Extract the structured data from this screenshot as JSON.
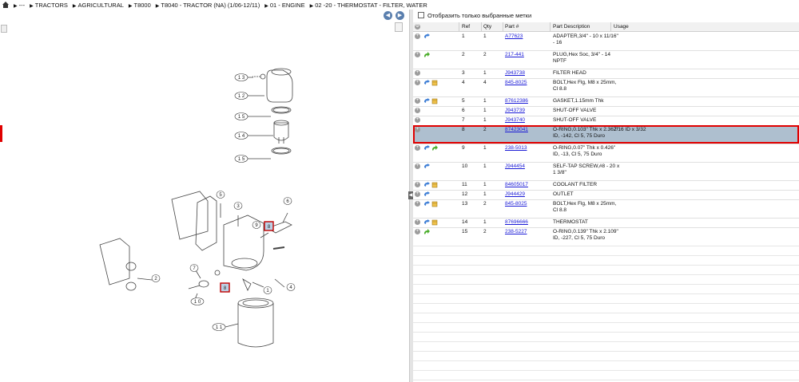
{
  "breadcrumb": {
    "items": [
      {
        "label": "---"
      },
      {
        "label": "TRACTORS"
      },
      {
        "label": "AGRICULTURAL"
      },
      {
        "label": "T8000"
      },
      {
        "label": "T8040 - TRACTOR (NA) (1/06-12/11)"
      },
      {
        "label": "01 - ENGINE"
      },
      {
        "label": "02 -20 - THERMOSTAT - FILTER, WATER"
      }
    ]
  },
  "nav": {
    "back": "◀",
    "forward": "▶"
  },
  "filter": {
    "label": "Отобразить только выбранные метки"
  },
  "table": {
    "headers": {
      "ref": "Ref",
      "qty": "Qty",
      "part": "Part #",
      "desc": "Part Description",
      "usage": "Usage"
    },
    "rows": [
      {
        "ref": "1",
        "qty": "1",
        "part": "A77623",
        "desc1": "ADAPTER,3/4\" - 10 x 11/16\"",
        "desc2": "- 16",
        "usage": "",
        "icons": "blue"
      },
      {
        "ref": "2",
        "qty": "2",
        "part": "217-441",
        "desc1": "PLUG,Hex Soc, 3/4\" - 14",
        "desc2": "NPTF",
        "usage": "",
        "icons": "green"
      },
      {
        "ref": "3",
        "qty": "1",
        "part": "J943738",
        "desc1": "FILTER HEAD",
        "desc2": "",
        "usage": "",
        "icons": "none"
      },
      {
        "ref": "4",
        "qty": "4",
        "part": "845-8025",
        "desc1": "BOLT,Hex Flg, M8 x 25mm,",
        "desc2": "Cl 8.8",
        "usage": "",
        "icons": "blue-box"
      },
      {
        "ref": "5",
        "qty": "1",
        "part": "87612386",
        "desc1": "GASKET,1.15mm Thk",
        "desc2": "",
        "usage": "",
        "icons": "blue-box"
      },
      {
        "ref": "6",
        "qty": "1",
        "part": "J943739",
        "desc1": "SHUT-OFF VALVE",
        "desc2": "",
        "usage": "",
        "icons": "none"
      },
      {
        "ref": "7",
        "qty": "1",
        "part": "J943740",
        "desc1": "SHUT-OFF VALVE",
        "desc2": "",
        "usage": "",
        "icons": "none"
      },
      {
        "ref": "8",
        "qty": "2",
        "part": "87423041",
        "desc1": "O-RING,0.103\" Thk x 2.362\"",
        "desc2": "ID, -142, Cl 5, 75 Duro",
        "usage": "7/16 ID x 3/32",
        "icons": "none"
      },
      {
        "ref": "9",
        "qty": "1",
        "part": "238-5013",
        "desc1": "O-RING,0.07\" Thk x 0.426\"",
        "desc2": "ID, -13, Cl 5, 75 Duro",
        "usage": "",
        "icons": "blue-green"
      },
      {
        "ref": "10",
        "qty": "1",
        "part": "J944454",
        "desc1": "SELF-TAP SCREW,#8 - 20 x",
        "desc2": "1 3/8\"",
        "usage": "",
        "icons": "blue"
      },
      {
        "ref": "11",
        "qty": "1",
        "part": "84605017",
        "desc1": "COOLANT FILTER",
        "desc2": "",
        "usage": "",
        "icons": "blue-box"
      },
      {
        "ref": "12",
        "qty": "1",
        "part": "J944429",
        "desc1": "OUTLET",
        "desc2": "",
        "usage": "",
        "icons": "blue"
      },
      {
        "ref": "13",
        "qty": "2",
        "part": "845-8025",
        "desc1": "BOLT,Hex Flg, M8 x 25mm,",
        "desc2": "Cl 8.8",
        "usage": "",
        "icons": "blue-box"
      },
      {
        "ref": "14",
        "qty": "1",
        "part": "87696666",
        "desc1": "THERMOSTAT",
        "desc2": "",
        "usage": "",
        "icons": "blue-box"
      },
      {
        "ref": "15",
        "qty": "2",
        "part": "238-5227",
        "desc1": "O-RING,0.139\" Thk x 2.109\"",
        "desc2": "ID, -227, Cl 5, 75 Duro",
        "usage": "",
        "icons": "green"
      }
    ]
  },
  "diagram": {
    "callouts": [
      "1 3",
      "1 2",
      "1 5",
      "1 4",
      "1 5",
      "5",
      "3",
      "6",
      "9",
      "8",
      "2",
      "7",
      "8",
      "1",
      "4",
      "1 0",
      "1 1"
    ]
  },
  "colors": {
    "selected_row": "#aebfcf",
    "highlight": "#e00000",
    "link": "#1a1ad6"
  }
}
